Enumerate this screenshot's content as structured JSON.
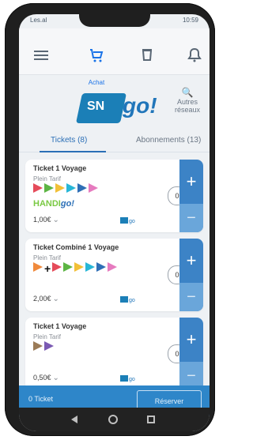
{
  "status": {
    "left": "Les.al",
    "right": "10:59"
  },
  "nav": {
    "active_label": "Achat"
  },
  "brand": {
    "sn": "SN",
    "go": "go!"
  },
  "search": {
    "lines": [
      "Autres",
      "réseaux"
    ]
  },
  "tabs": [
    {
      "label": "Tickets (8)"
    },
    {
      "label": "Abonnements (13)"
    }
  ],
  "cards": [
    {
      "title": "Ticket 1 Voyage",
      "subtitle": "Plein Tarif",
      "price": "1,00€",
      "qty": "0",
      "handigo": true
    },
    {
      "title": "Ticket Combiné 1 Voyage",
      "subtitle": "Plein Tarif",
      "price": "2,00€",
      "qty": "0",
      "handigo": false
    },
    {
      "title": "Ticket 1 Voyage",
      "subtitle": "Plein Tarif",
      "price": "0,50€",
      "qty": "0",
      "handigo": false
    }
  ],
  "cta": {
    "count": "0 Ticket",
    "reserve": "Réserver"
  },
  "handigo": {
    "handi": "HANDI",
    "go": "go!"
  }
}
